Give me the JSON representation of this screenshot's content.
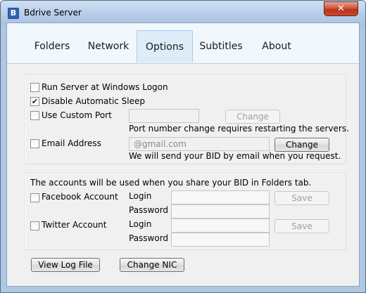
{
  "window": {
    "title": "Bdrive Server",
    "icon_letter": "B",
    "close_glyph": "✕"
  },
  "tabs": [
    {
      "label": "Folders",
      "active": false
    },
    {
      "label": "Network",
      "active": false
    },
    {
      "label": "Options",
      "active": true
    },
    {
      "label": "Subtitles",
      "active": false
    },
    {
      "label": "About",
      "active": false
    }
  ],
  "options": {
    "run_at_logon": {
      "label": "Run Server at Windows Logon",
      "checked": false
    },
    "disable_sleep": {
      "label": "Disable Automatic Sleep",
      "checked": true
    },
    "custom_port": {
      "label": "Use Custom Port",
      "checked": false,
      "value": "",
      "button": "Change",
      "note": "Port number change requires restarting the servers."
    },
    "email": {
      "label": "Email Address",
      "checked": false,
      "placeholder": "@gmail.com",
      "button": "Change",
      "note": "We will send your BID by email when you request."
    }
  },
  "accounts": {
    "intro": "The accounts will be used when you share your BID in Folders tab.",
    "login_label": "Login",
    "password_label": "Password",
    "save_label": "Save",
    "facebook": {
      "label": "Facebook Account",
      "checked": false
    },
    "twitter": {
      "label": "Twitter Account",
      "checked": false
    }
  },
  "footer": {
    "view_log": "View Log File",
    "change_nic": "Change NIC"
  }
}
